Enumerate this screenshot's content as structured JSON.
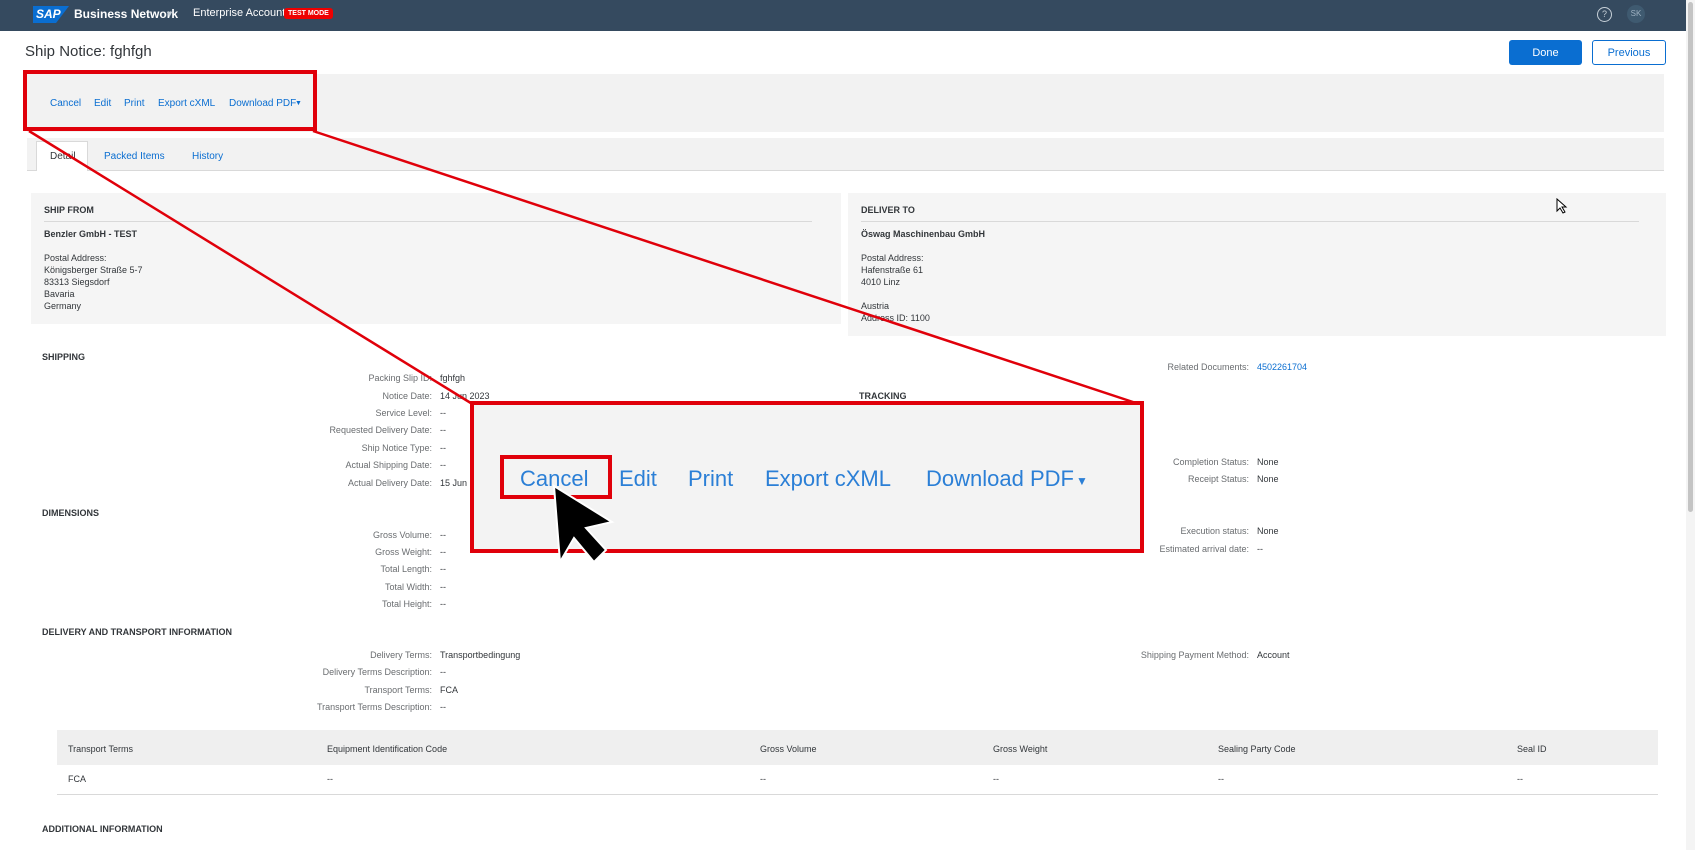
{
  "shell": {
    "logo": "SAP",
    "brand": "Business Network",
    "account": "Enterprise Account",
    "test_mode": "TEST MODE",
    "help_icon": "?",
    "avatar": "SK"
  },
  "header": {
    "title": "Ship Notice: fghfgh",
    "done_label": "Done",
    "previous_label": "Previous"
  },
  "toolbar": {
    "cancel": "Cancel",
    "edit": "Edit",
    "print": "Print",
    "export": "Export cXML",
    "download": "Download PDF"
  },
  "tabs": {
    "detail": "Detail",
    "packed_items": "Packed Items",
    "history": "History"
  },
  "ship_from": {
    "heading": "SHIP FROM",
    "name": "Benzler GmbH - TEST",
    "postal_label": "Postal Address:",
    "street": "Königsberger Straße 5-7",
    "city": "83313 Siegsdorf",
    "region": "Bavaria",
    "country": "Germany"
  },
  "deliver_to": {
    "heading": "DELIVER TO",
    "name": "Öswag Maschinenbau GmbH",
    "postal_label": "Postal Address:",
    "street": "Hafenstraße 61",
    "city": "4010 Linz",
    "country": "Austria",
    "address_id": "Address ID: 1100"
  },
  "shipping": {
    "title": "SHIPPING",
    "rows": [
      {
        "label": "Packing Slip ID:",
        "value": "fghfgh"
      },
      {
        "label": "Notice Date:",
        "value": "14 Jun 2023"
      },
      {
        "label": "Service Level:",
        "value": "--"
      },
      {
        "label": "Requested Delivery Date:",
        "value": "--"
      },
      {
        "label": "Ship Notice Type:",
        "value": "--"
      },
      {
        "label": "Actual Shipping Date:",
        "value": "--"
      },
      {
        "label": "Actual Delivery Date:",
        "value": "15 Jun"
      }
    ],
    "related_label": "Related Documents:",
    "related_value": "4502261704"
  },
  "tracking": {
    "title": "TRACKING",
    "completion_label": "Completion Status:",
    "completion_value": "None",
    "receipt_label": "Receipt Status:",
    "receipt_value": "None",
    "execution_label": "Execution status:",
    "execution_value": "None",
    "arrival_label": "Estimated arrival date:",
    "arrival_value": "--"
  },
  "dimensions": {
    "title": "DIMENSIONS",
    "rows": [
      {
        "label": "Gross Volume:",
        "value": "--"
      },
      {
        "label": "Gross Weight:",
        "value": "--"
      },
      {
        "label": "Total Length:",
        "value": "--"
      },
      {
        "label": "Total Width:",
        "value": "--"
      },
      {
        "label": "Total Height:",
        "value": "--"
      }
    ]
  },
  "delivery": {
    "title": "DELIVERY AND TRANSPORT INFORMATION",
    "rows": [
      {
        "label": "Delivery Terms:",
        "value": "Transportbedingung"
      },
      {
        "label": "Delivery Terms Description:",
        "value": "--"
      },
      {
        "label": "Transport Terms:",
        "value": "FCA"
      },
      {
        "label": "Transport Terms Description:",
        "value": "--"
      }
    ],
    "payment_label": "Shipping Payment Method:",
    "payment_value": "Account"
  },
  "table": {
    "headers": [
      "Transport Terms",
      "Equipment Identification Code",
      "Gross Volume",
      "Gross Weight",
      "Sealing Party Code",
      "Seal ID"
    ],
    "row": [
      "FCA",
      "--",
      "--",
      "--",
      "--",
      "--"
    ]
  },
  "additional": {
    "title": "ADDITIONAL INFORMATION"
  },
  "colors": {
    "shell": "#354a5f",
    "accent": "#0a6ed1",
    "highlight": "#e0000a",
    "test_mode": "#ee0000"
  },
  "icons": [
    "help-icon",
    "dropdown-caret-icon",
    "cursor-arrow-icon"
  ]
}
